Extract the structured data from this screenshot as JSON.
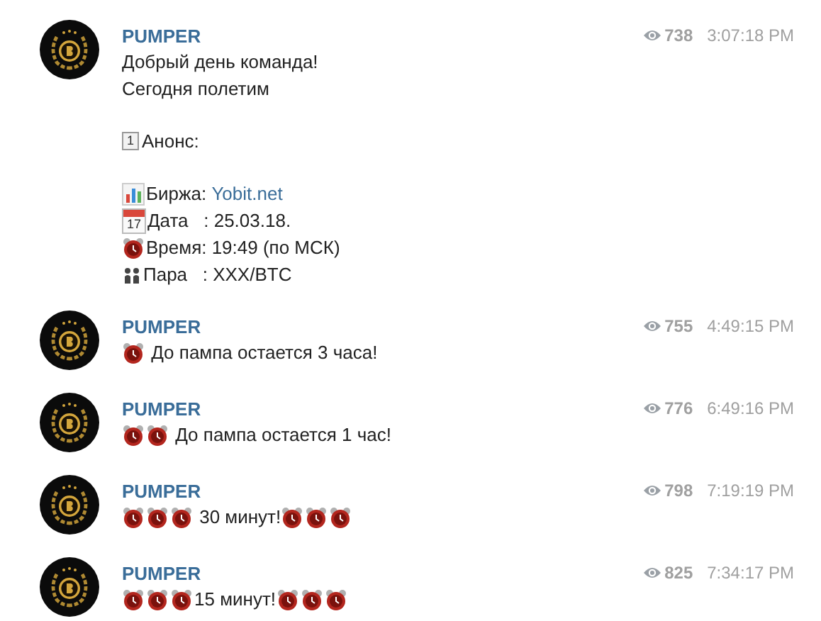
{
  "messages": [
    {
      "author": "PUMPER",
      "views": "738",
      "time": "3:07:18 PM",
      "paragraphs": [
        [
          [
            {
              "kind": "text",
              "text": "Добрый день команда!"
            }
          ],
          [
            {
              "kind": "text",
              "text": "Сегодня полетим"
            }
          ]
        ],
        [
          [
            {
              "kind": "keycap",
              "text": "1"
            },
            {
              "kind": "text",
              "text": "Анонс:"
            }
          ]
        ],
        [
          [
            {
              "kind": "chart"
            },
            {
              "kind": "text",
              "text": "Биржа: "
            },
            {
              "kind": "link",
              "text": "Yobit.net"
            }
          ],
          [
            {
              "kind": "calendar",
              "text": "17"
            },
            {
              "kind": "text",
              "text": "Дата   : 25.03.18."
            }
          ],
          [
            {
              "kind": "alarm"
            },
            {
              "kind": "text",
              "text": "Время: 19:49 (по МСК)"
            }
          ],
          [
            {
              "kind": "couple"
            },
            {
              "kind": "text",
              "text": "Пара   : XXX/BTC"
            }
          ]
        ]
      ]
    },
    {
      "author": "PUMPER",
      "views": "755",
      "time": "4:49:15 PM",
      "paragraphs": [
        [
          [
            {
              "kind": "alarm"
            },
            {
              "kind": "text",
              "text": " До пампа остается 3 часа!"
            }
          ]
        ]
      ]
    },
    {
      "author": "PUMPER",
      "views": "776",
      "time": "6:49:16 PM",
      "paragraphs": [
        [
          [
            {
              "kind": "alarm"
            },
            {
              "kind": "alarm"
            },
            {
              "kind": "text",
              "text": " До пампа остается 1 час!"
            }
          ]
        ]
      ]
    },
    {
      "author": "PUMPER",
      "views": "798",
      "time": "7:19:19 PM",
      "paragraphs": [
        [
          [
            {
              "kind": "alarm"
            },
            {
              "kind": "alarm"
            },
            {
              "kind": "alarm"
            },
            {
              "kind": "text",
              "text": " 30 минут!"
            },
            {
              "kind": "alarm"
            },
            {
              "kind": "alarm"
            },
            {
              "kind": "alarm"
            }
          ]
        ]
      ]
    },
    {
      "author": "PUMPER",
      "views": "825",
      "time": "7:34:17 PM",
      "paragraphs": [
        [
          [
            {
              "kind": "alarm"
            },
            {
              "kind": "alarm"
            },
            {
              "kind": "alarm"
            },
            {
              "kind": "text",
              "text": "15 минут!"
            },
            {
              "kind": "alarm"
            },
            {
              "kind": "alarm"
            },
            {
              "kind": "alarm"
            }
          ]
        ]
      ]
    }
  ]
}
